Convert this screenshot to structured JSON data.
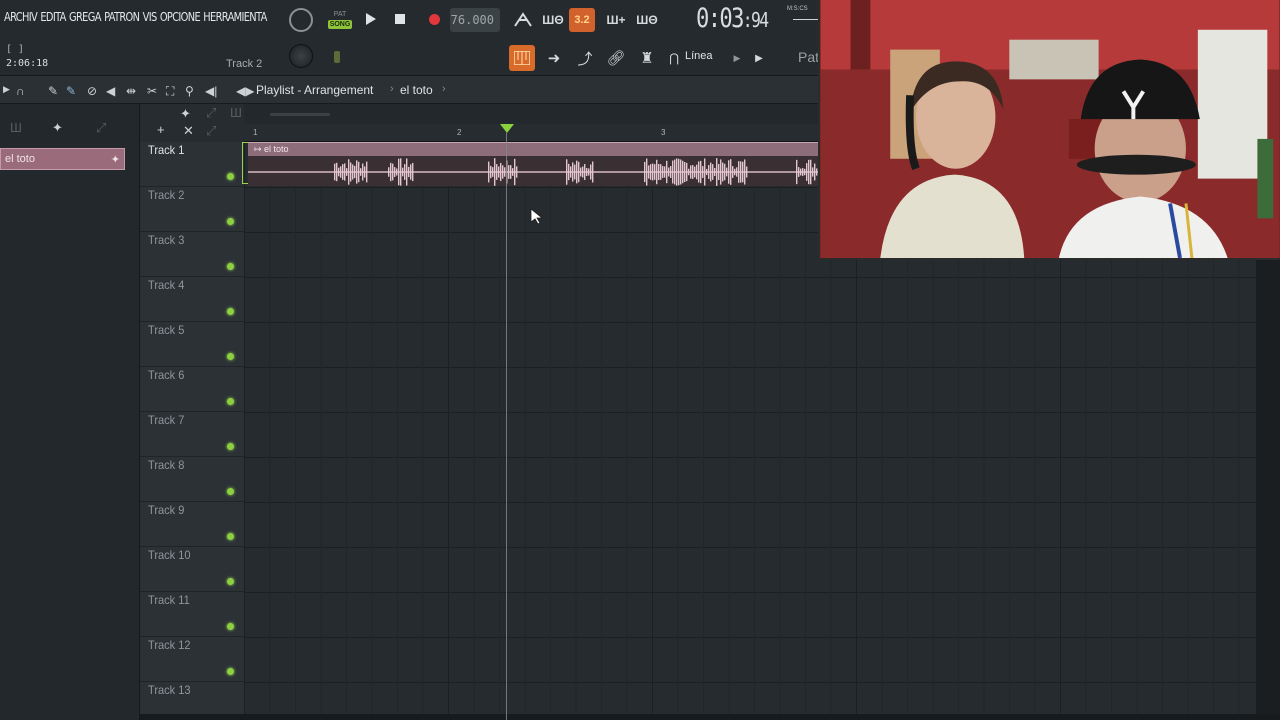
{
  "menu": [
    "ARCHIV",
    "EDITA",
    "GREGA",
    "PATRON",
    "VIS",
    "OPCIONE",
    "HERRAMIENTA"
  ],
  "hint": {
    "bracket": "[ ]",
    "time": "2:06:18",
    "track": "Track 2"
  },
  "transport": {
    "pat_label": "PAT",
    "song_label": "SONG",
    "tempo": "76.000",
    "step_label": "3.2"
  },
  "time_display": {
    "main": "0:03",
    "sub": ":94",
    "unit": "M:S:CS"
  },
  "toolbar": {
    "snap_label": "Línea",
    "pattern_label": "Patt"
  },
  "playlist": {
    "title": "Playlist - Arrangement",
    "pattern": "el toto",
    "sep": "›"
  },
  "picker": {
    "item_label": "el toto"
  },
  "ruler": {
    "bars": [
      "1",
      "2",
      "3"
    ]
  },
  "clip": {
    "name": "el toto",
    "track": 1,
    "start_bar": 1
  },
  "tracks": [
    "Track 1",
    "Track 2",
    "Track 3",
    "Track 4",
    "Track 5",
    "Track 6",
    "Track 7",
    "Track 8",
    "Track 9",
    "Track 10",
    "Track 11",
    "Track 12",
    "Track 13"
  ],
  "colors": {
    "accent_green": "#8bd13f",
    "accent_orange": "#d86a2a",
    "clip_pink": "#8d6d79",
    "record_red": "#e0383c"
  }
}
